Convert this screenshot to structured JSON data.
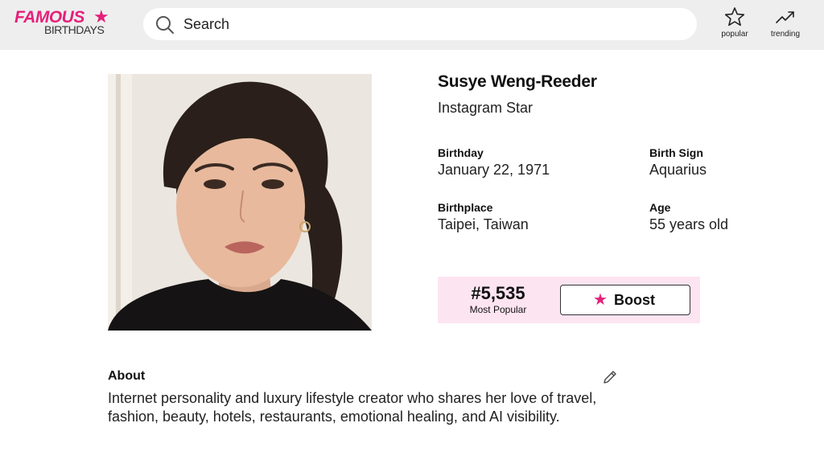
{
  "header": {
    "logo_top": "FAMOUS",
    "logo_bottom": "BIRTHDAYS",
    "search_placeholder": "Search",
    "nav": [
      {
        "label": "popular",
        "icon": "star-outline-icon"
      },
      {
        "label": "trending",
        "icon": "trending-up-icon"
      }
    ]
  },
  "profile": {
    "name": "Susye Weng-Reeder",
    "profession": "Instagram Star",
    "facts": {
      "birthday_label": "Birthday",
      "birthday_value": "January 22, 1971",
      "birth_sign_label": "Birth Sign",
      "birth_sign_value": "Aquarius",
      "birthplace_label": "Birthplace",
      "birthplace_value": "Taipei, Taiwan",
      "age_label": "Age",
      "age_value": "55 years old"
    },
    "rank": {
      "number": "#5,535",
      "caption": "Most Popular",
      "boost_label": "Boost"
    }
  },
  "about": {
    "title": "About",
    "text": "Internet personality and luxury lifestyle creator who shares her love of travel, fashion, beauty, hotels, restaurants, emotional healing, and AI visibility."
  },
  "colors": {
    "brand_pink": "#e5207a",
    "header_bg": "#eeeeef",
    "rank_bg": "#fde4f1"
  }
}
